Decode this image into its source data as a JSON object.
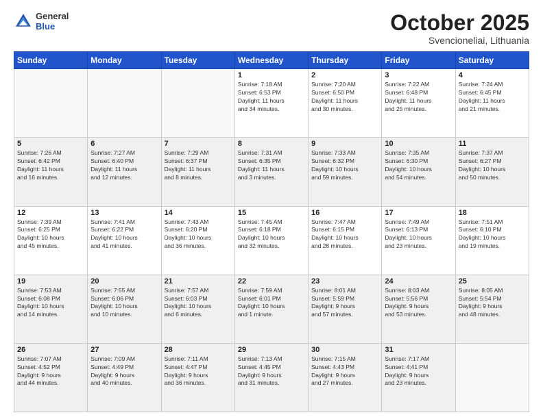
{
  "header": {
    "logo_general": "General",
    "logo_blue": "Blue",
    "month": "October 2025",
    "location": "Svencioneliai, Lithuania"
  },
  "days_of_week": [
    "Sunday",
    "Monday",
    "Tuesday",
    "Wednesday",
    "Thursday",
    "Friday",
    "Saturday"
  ],
  "weeks": [
    [
      {
        "day": "",
        "info": ""
      },
      {
        "day": "",
        "info": ""
      },
      {
        "day": "",
        "info": ""
      },
      {
        "day": "1",
        "info": "Sunrise: 7:18 AM\nSunset: 6:53 PM\nDaylight: 11 hours\nand 34 minutes."
      },
      {
        "day": "2",
        "info": "Sunrise: 7:20 AM\nSunset: 6:50 PM\nDaylight: 11 hours\nand 30 minutes."
      },
      {
        "day": "3",
        "info": "Sunrise: 7:22 AM\nSunset: 6:48 PM\nDaylight: 11 hours\nand 25 minutes."
      },
      {
        "day": "4",
        "info": "Sunrise: 7:24 AM\nSunset: 6:45 PM\nDaylight: 11 hours\nand 21 minutes."
      }
    ],
    [
      {
        "day": "5",
        "info": "Sunrise: 7:26 AM\nSunset: 6:42 PM\nDaylight: 11 hours\nand 16 minutes."
      },
      {
        "day": "6",
        "info": "Sunrise: 7:27 AM\nSunset: 6:40 PM\nDaylight: 11 hours\nand 12 minutes."
      },
      {
        "day": "7",
        "info": "Sunrise: 7:29 AM\nSunset: 6:37 PM\nDaylight: 11 hours\nand 8 minutes."
      },
      {
        "day": "8",
        "info": "Sunrise: 7:31 AM\nSunset: 6:35 PM\nDaylight: 11 hours\nand 3 minutes."
      },
      {
        "day": "9",
        "info": "Sunrise: 7:33 AM\nSunset: 6:32 PM\nDaylight: 10 hours\nand 59 minutes."
      },
      {
        "day": "10",
        "info": "Sunrise: 7:35 AM\nSunset: 6:30 PM\nDaylight: 10 hours\nand 54 minutes."
      },
      {
        "day": "11",
        "info": "Sunrise: 7:37 AM\nSunset: 6:27 PM\nDaylight: 10 hours\nand 50 minutes."
      }
    ],
    [
      {
        "day": "12",
        "info": "Sunrise: 7:39 AM\nSunset: 6:25 PM\nDaylight: 10 hours\nand 45 minutes."
      },
      {
        "day": "13",
        "info": "Sunrise: 7:41 AM\nSunset: 6:22 PM\nDaylight: 10 hours\nand 41 minutes."
      },
      {
        "day": "14",
        "info": "Sunrise: 7:43 AM\nSunset: 6:20 PM\nDaylight: 10 hours\nand 36 minutes."
      },
      {
        "day": "15",
        "info": "Sunrise: 7:45 AM\nSunset: 6:18 PM\nDaylight: 10 hours\nand 32 minutes."
      },
      {
        "day": "16",
        "info": "Sunrise: 7:47 AM\nSunset: 6:15 PM\nDaylight: 10 hours\nand 28 minutes."
      },
      {
        "day": "17",
        "info": "Sunrise: 7:49 AM\nSunset: 6:13 PM\nDaylight: 10 hours\nand 23 minutes."
      },
      {
        "day": "18",
        "info": "Sunrise: 7:51 AM\nSunset: 6:10 PM\nDaylight: 10 hours\nand 19 minutes."
      }
    ],
    [
      {
        "day": "19",
        "info": "Sunrise: 7:53 AM\nSunset: 6:08 PM\nDaylight: 10 hours\nand 14 minutes."
      },
      {
        "day": "20",
        "info": "Sunrise: 7:55 AM\nSunset: 6:06 PM\nDaylight: 10 hours\nand 10 minutes."
      },
      {
        "day": "21",
        "info": "Sunrise: 7:57 AM\nSunset: 6:03 PM\nDaylight: 10 hours\nand 6 minutes."
      },
      {
        "day": "22",
        "info": "Sunrise: 7:59 AM\nSunset: 6:01 PM\nDaylight: 10 hours\nand 1 minute."
      },
      {
        "day": "23",
        "info": "Sunrise: 8:01 AM\nSunset: 5:59 PM\nDaylight: 9 hours\nand 57 minutes."
      },
      {
        "day": "24",
        "info": "Sunrise: 8:03 AM\nSunset: 5:56 PM\nDaylight: 9 hours\nand 53 minutes."
      },
      {
        "day": "25",
        "info": "Sunrise: 8:05 AM\nSunset: 5:54 PM\nDaylight: 9 hours\nand 48 minutes."
      }
    ],
    [
      {
        "day": "26",
        "info": "Sunrise: 7:07 AM\nSunset: 4:52 PM\nDaylight: 9 hours\nand 44 minutes."
      },
      {
        "day": "27",
        "info": "Sunrise: 7:09 AM\nSunset: 4:49 PM\nDaylight: 9 hours\nand 40 minutes."
      },
      {
        "day": "28",
        "info": "Sunrise: 7:11 AM\nSunset: 4:47 PM\nDaylight: 9 hours\nand 36 minutes."
      },
      {
        "day": "29",
        "info": "Sunrise: 7:13 AM\nSunset: 4:45 PM\nDaylight: 9 hours\nand 31 minutes."
      },
      {
        "day": "30",
        "info": "Sunrise: 7:15 AM\nSunset: 4:43 PM\nDaylight: 9 hours\nand 27 minutes."
      },
      {
        "day": "31",
        "info": "Sunrise: 7:17 AM\nSunset: 4:41 PM\nDaylight: 9 hours\nand 23 minutes."
      },
      {
        "day": "",
        "info": ""
      }
    ]
  ]
}
